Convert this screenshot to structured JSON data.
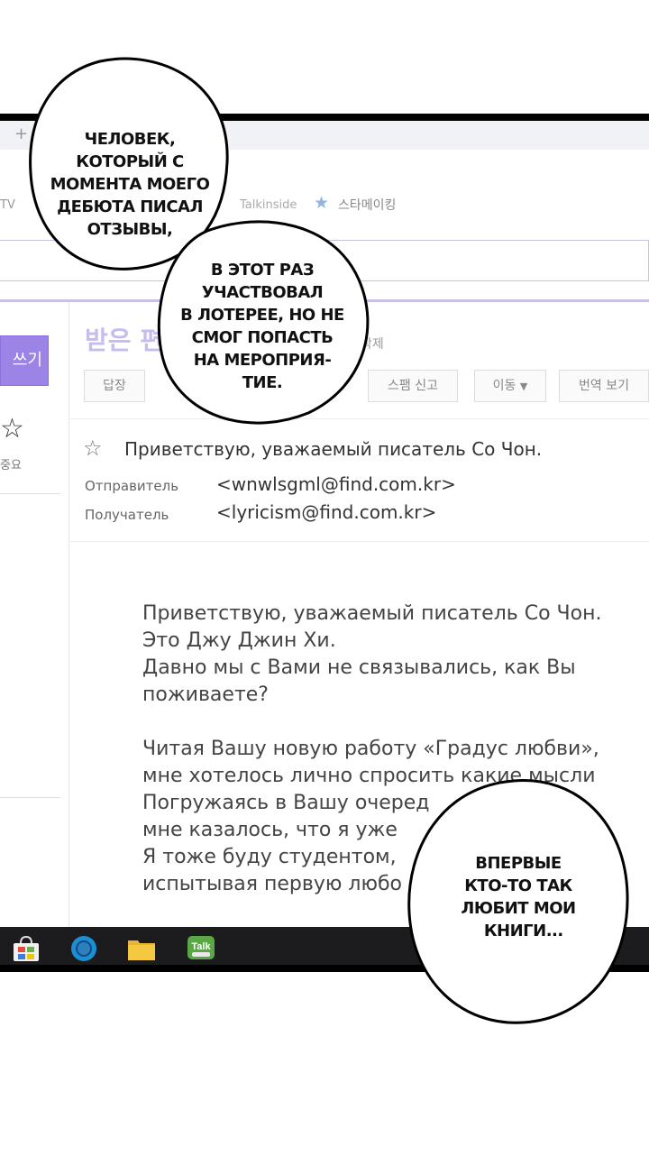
{
  "browser": {
    "new_tab_symbol": "+",
    "bookmarks": {
      "tv": "TV",
      "talkinside": "Talkinside",
      "starmaking": "스타메이킹"
    }
  },
  "mail": {
    "write_button": "쓰기",
    "sidebar_important": "중요",
    "inbox_title": "받은 편",
    "delete_label": "삭제",
    "toolbar": {
      "reply": "답장",
      "spam": "스팸 신고",
      "move": "이동",
      "translate": "번역 보기"
    },
    "subject": "Приветствую, уважаемый писатель Со Чон.",
    "from_label": "Отправитель",
    "from_value": "<wnwlsgml@find.com.kr>",
    "to_label": "Получатель",
    "to_value": "<lyricism@find.com.kr>",
    "body": "Приветствую, уважаемый писатель Со Чон.\nЭто Джу Джин Хи.\nДавно мы с Вами не связывались, как Вы\nпоживаете?\n\nЧитая Вашу новую работу «Градус любви»,\nмне хотелось лично спросить какие мысли\nПогружаясь в Вашу очеред\nмне казалось, что я уже\nЯ тоже буду студентом,\nиспытывая первую любо"
  },
  "taskbar": {
    "talk_icon_label": "Talk"
  },
  "bubbles": {
    "b1": "ЧЕЛОВЕК,\nКОТОРЫЙ С\nМОМЕНТА МОЕГО\nДЕБЮТА ПИСАЛ\nОТЗЫВЫ,",
    "b2": "В ЭТОТ РАЗ\nУЧАСТВОВАЛ\nВ ЛОТЕРЕЕ, НО НЕ\nСМОГ ПОПАСТЬ\nНА МЕРОПРИЯ-\nТИЕ.",
    "b3": "ВПЕРВЫЕ\nКТО-ТО ТАК\nЛЮБИТ МОИ\n  КНИГИ..."
  }
}
